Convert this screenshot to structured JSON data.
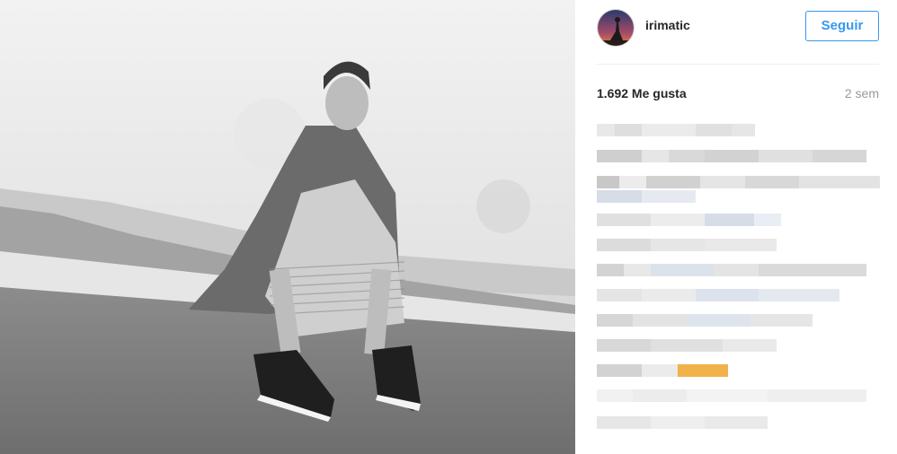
{
  "post": {
    "username": "irimatic",
    "follow_label": "Seguir",
    "likes_label": "1.692 Me gusta",
    "time_label": "2 sem"
  },
  "icons": {
    "avatar": "avatar-image",
    "photo": "post-photo"
  },
  "colors": {
    "accent": "#3897f0",
    "text": "#262626",
    "muted": "#999999",
    "divider": "#efefef"
  }
}
